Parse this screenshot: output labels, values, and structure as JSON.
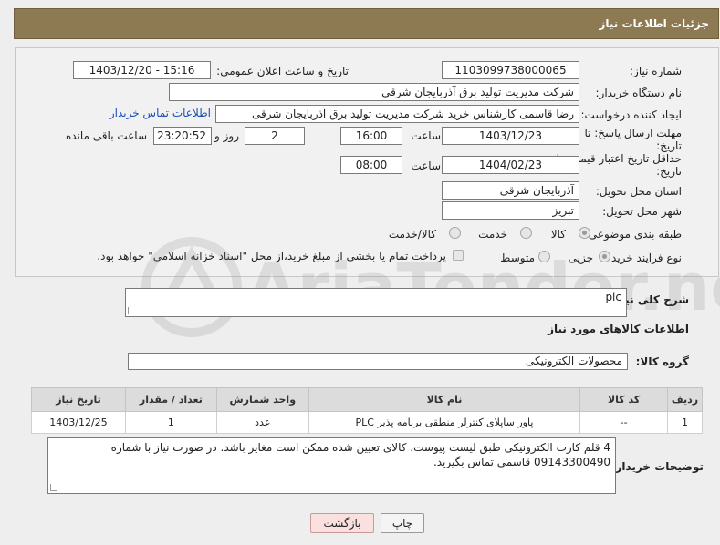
{
  "header": {
    "title": "جزئیات اطلاعات نیاز"
  },
  "form": {
    "need_number_label": "شماره نیاز:",
    "need_number": "1103099738000065",
    "announce_label": "تاریخ و ساعت اعلان عمومی:",
    "announce_value": "1403/12/20 - 15:16",
    "buyer_label": "نام دستگاه خریدار:",
    "buyer_value": "شرکت مدیریت تولید برق آذربایجان شرقی",
    "creator_label": "ایجاد کننده درخواست:",
    "creator_value": "رضا قاسمی کارشناس خرید شرکت مدیریت تولید برق آذربایجان شرقی",
    "contact_link": "اطلاعات تماس خریدار",
    "deadline_label_1": "مهلت ارسال پاسخ: تا",
    "deadline_label_2": "تاریخ:",
    "deadline_date": "1403/12/23",
    "time_label": "ساعت",
    "deadline_time": "16:00",
    "days_value": "2",
    "days_label": "روز و",
    "remaining_value": "23:20:52",
    "remaining_label": "ساعت باقی مانده",
    "validity_label_1": "حداقل تاریخ اعتبار قیمت: تا",
    "validity_label_2": "تاریخ:",
    "validity_date": "1404/02/23",
    "validity_time": "08:00",
    "province_label": "استان محل تحویل:",
    "province_value": "آذربایجان شرقی",
    "city_label": "شهر محل تحویل:",
    "city_value": "تبریز",
    "category_label": "طبقه بندی موضوعی:",
    "category_options": [
      "کالا",
      "خدمت",
      "کالا/خدمت"
    ],
    "process_label": "نوع فرآیند خرید :",
    "process_options": [
      "جزیی",
      "متوسط"
    ],
    "payment_note": "پرداخت تمام یا بخشی از مبلغ خرید،از محل \"اسناد خزانه اسلامی\" خواهد بود."
  },
  "summary": {
    "label": "شرح کلی نیاز:",
    "value": "plc"
  },
  "goods_info_title": "اطلاعات کالاهای مورد نیاز",
  "goods_group": {
    "label": "گروه کالا:",
    "value": "محصولات الکترونیکی"
  },
  "table": {
    "headers": [
      "ردیف",
      "کد کالا",
      "نام کالا",
      "واحد شمارش",
      "تعداد / مقدار",
      "تاریخ نیاز"
    ],
    "rows": [
      [
        "1",
        "--",
        "پاور ساپلای کنترلر منطقی برنامه پذیر PLC",
        "عدد",
        "1",
        "1403/12/25"
      ]
    ]
  },
  "buyer_notes": {
    "label": "توضیحات خریدار:",
    "value": "4 قلم کارت الکترونیکی طبق لیست پیوست، کالای تعیین شده ممکن است مغایر باشد. در صورت نیاز با شماره 09143300490 قاسمی تماس بگیرید."
  },
  "buttons": {
    "print": "چاپ",
    "back": "بازگشت"
  },
  "watermark": {
    "text": "AriaTender.neT"
  }
}
